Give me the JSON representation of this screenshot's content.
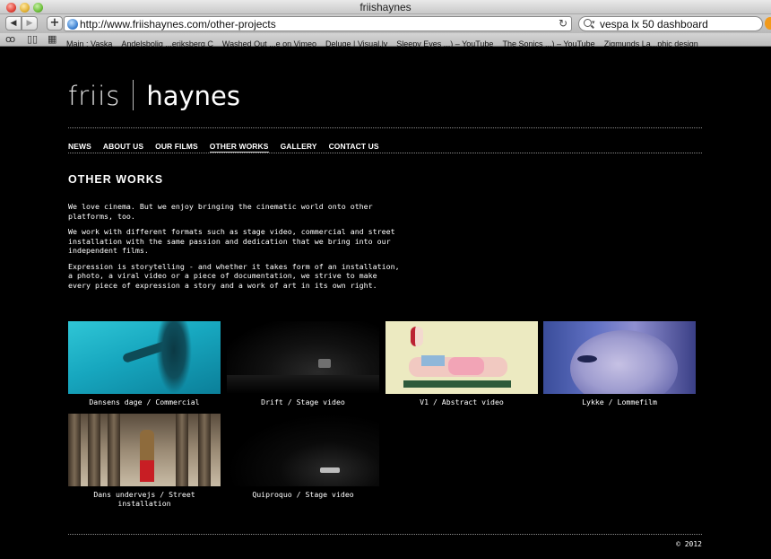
{
  "browser": {
    "window_title": "friishaynes",
    "url": "http://www.friishaynes.com/other-projects",
    "search_query": "vespa lx 50 dashboard",
    "bookmarks": [
      "Main : Vaska",
      "Andelsbolig ...eriksberg C",
      "Washed Out ...e on Vimeo",
      "Deluge | Visual.ly",
      "Sleepy Eyes ...) – YouTube",
      "The Sonics ...) – YouTube",
      "Zigmunds La...phic design"
    ]
  },
  "logo": {
    "left": "friis",
    "right": "haynes"
  },
  "nav": {
    "items": [
      "NEWS",
      "ABOUT US",
      "OUR FILMS",
      "OTHER WORKS",
      "GALLERY",
      "CONTACT US"
    ],
    "active": "OTHER WORKS"
  },
  "page": {
    "title": "OTHER WORKS",
    "paragraphs": [
      "We love cinema. But we enjoy bringing the cinematic world onto other platforms, too.",
      "We work with different formats such as stage video, commercial and street installation with the same passion and dedication that we bring into our independent films.",
      "Expression is storytelling - and whether it takes form of an installation, a photo, a viral video or a piece of documentation, we strive to make every piece of expression a story and a work of art in its own right."
    ]
  },
  "works": [
    {
      "caption": "Dansens dage / Commercial"
    },
    {
      "caption": "Drift / Stage video"
    },
    {
      "caption": "V1 / Abstract video"
    },
    {
      "caption": "Lykke / Lommefilm"
    },
    {
      "caption": "Dans undervejs / Street installation"
    },
    {
      "caption": "Quiproquo / Stage video"
    }
  ],
  "footer": {
    "copyright": "© 2012"
  },
  "colors": {
    "background": "#000000",
    "text": "#ffffff",
    "rule": "#8a8a8a"
  }
}
